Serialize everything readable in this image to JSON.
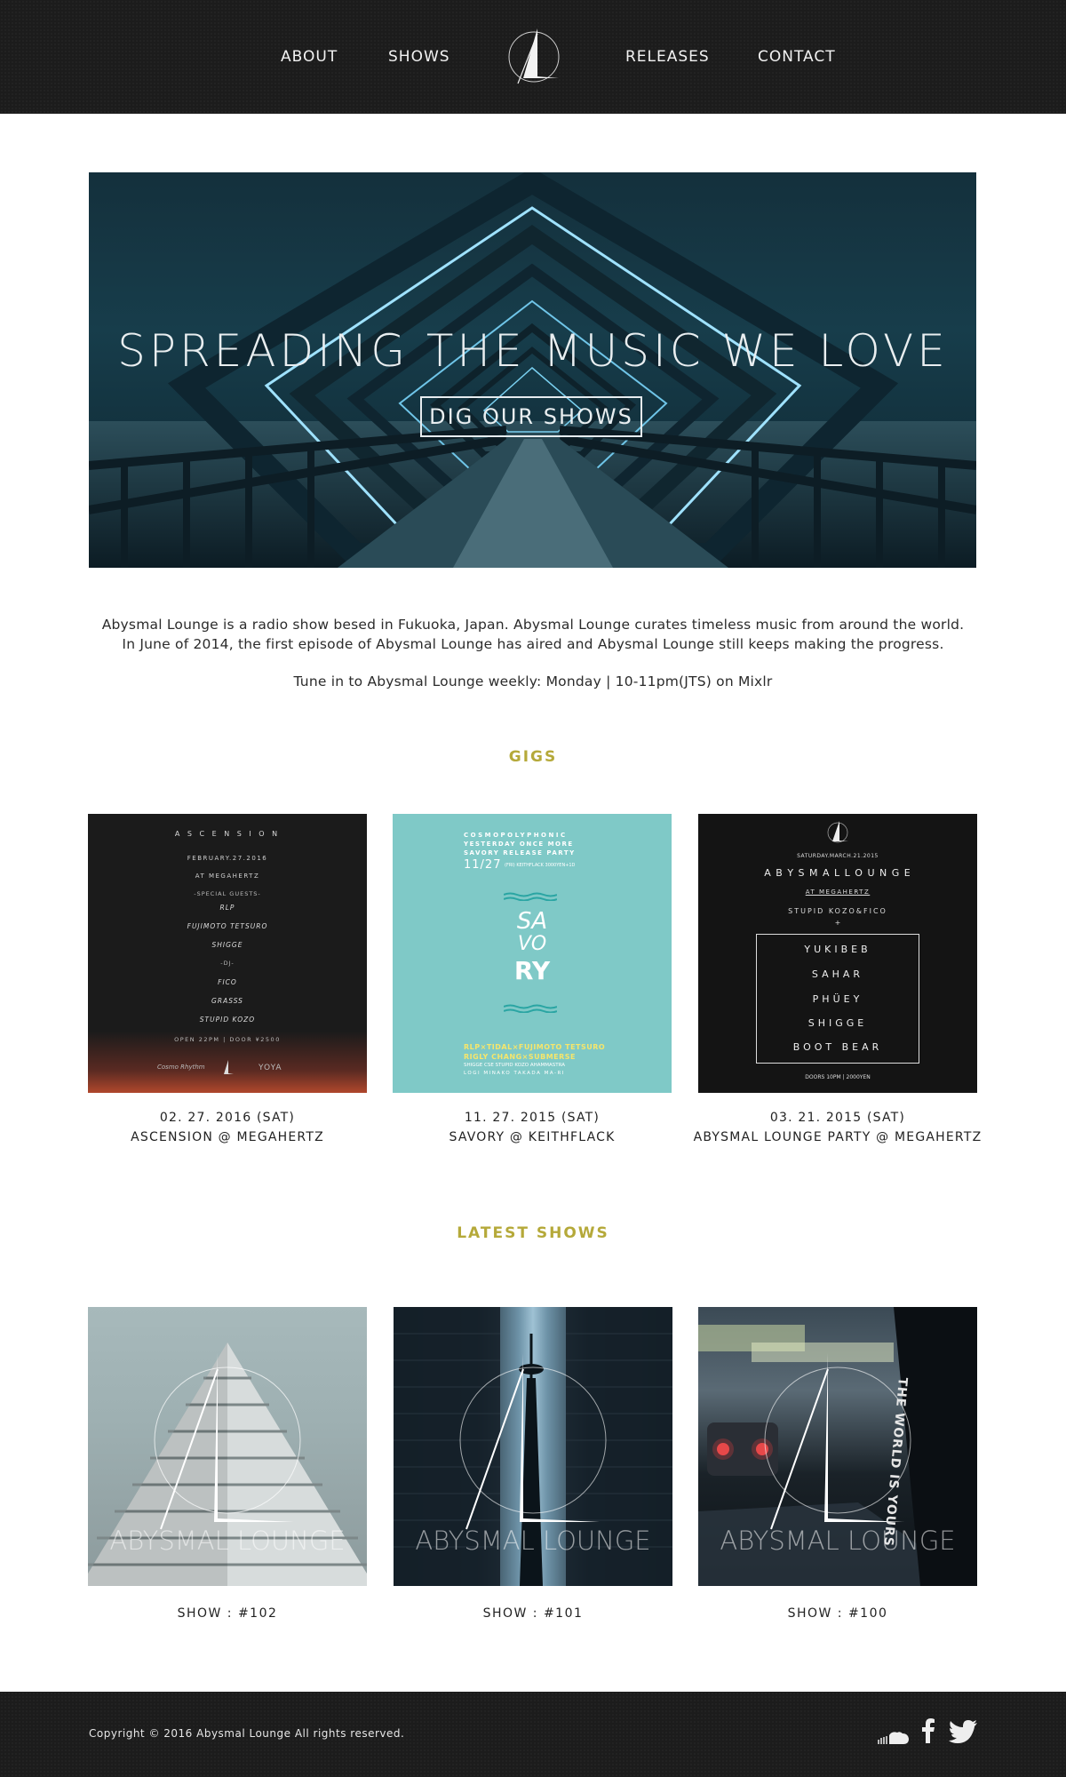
{
  "nav": {
    "items": [
      {
        "label": "ABOUT"
      },
      {
        "label": "SHOWS"
      },
      {
        "label": "RELEASES"
      },
      {
        "label": "CONTACT"
      }
    ]
  },
  "hero": {
    "title": "SPREADING THE MUSIC WE LOVE",
    "button_label": "DIG OUR SHOWS"
  },
  "intro": {
    "line1": "Abysmal Lounge is a radio show besed in Fukuoka, Japan. Abysmal Lounge curates timeless music from around the world.",
    "line2": "In June of 2014, the first episode of Abysmal Lounge has aired and Abysmal Lounge still keeps making the progress.",
    "tune_in": "Tune in to Abysmal Lounge weekly: Monday | 10-11pm(JTS) on Mixlr"
  },
  "gigs": {
    "title": "GIGS",
    "items": [
      {
        "date": "02. 27. 2016 (SAT)",
        "name": "ASCENSION @ MEGAHERTZ",
        "poster": {
          "title": "A S C E N S I O N",
          "date": "FEBRUARY.27.2016",
          "venue": "AT MEGAHERTZ",
          "guests_label": "-SPECIAL GUESTS-",
          "guests": [
            "RLP",
            "FUJIMOTO TETSURO",
            "SHIGGE"
          ],
          "dj_label": "-DJ-",
          "djs": [
            "FICO",
            "GRASSS",
            "STUPID KOZO"
          ],
          "footer": "OPEN 22PM | DOOR ¥2500",
          "marks": [
            "Cosmo Rhythm",
            "YOYA"
          ]
        }
      },
      {
        "date": "11. 27. 2015 (SAT)",
        "name": "SAVORY @ KEITHFLACK",
        "poster": {
          "line1": "COSMOPOLYPHONIC",
          "line2": "YESTERDAY ONCE MORE",
          "line3": "SAVORY RELEASE PARTY",
          "date": "11/27",
          "date_detail": "(FRI) KEITHFLACK 3000YEN+1D",
          "logo": [
            "SA",
            "VO",
            "RY"
          ],
          "artists1": "RLP×TIDAL×FUJIMOTO TETSURO",
          "artists2": "RIGLY CHANG×SUBMERSE",
          "artists3": "SHIGGE  CSE  STUPID KOZO  AHAMMASTRA",
          "artists4": "LOGI  MINAKO TAKADA  MA-RI"
        }
      },
      {
        "date": "03. 21. 2015 (SAT)",
        "name": "ABYSMAL LOUNGE PARTY @ MEGAHERTZ",
        "poster": {
          "date": "SATURDAY.MARCH.21.2015",
          "title": "A B Y S M A L   L O U N G E",
          "venue": "AT MEGAHERTZ",
          "hosts": "STUPID KOZO&FICO",
          "plus": "+",
          "lineup": [
            "YUKIBEB",
            "SAHAR",
            "PHÜEY",
            "SHIGGE",
            "BOOT BEAR"
          ],
          "footer": "DOORS 10PM | 2000YEN"
        }
      }
    ]
  },
  "latest": {
    "title": "LATEST SHOWS",
    "brand": "ABYSMAL LOUNGE",
    "items": [
      {
        "label": "SHOW : #102"
      },
      {
        "label": "SHOW : #101"
      },
      {
        "label": "SHOW : #100"
      }
    ],
    "sign_text": "THE WORLD IS YOURS"
  },
  "footer": {
    "copyright": "Copyright © 2016 Abysmal Lounge All rights reserved."
  },
  "colors": {
    "header_bg": "#1c1c1c",
    "accent": "#b5a93a",
    "poster_teal": "#7fc9c7"
  },
  "icons": [
    "logo-icon",
    "soundcloud-icon",
    "facebook-icon",
    "twitter-icon"
  ]
}
